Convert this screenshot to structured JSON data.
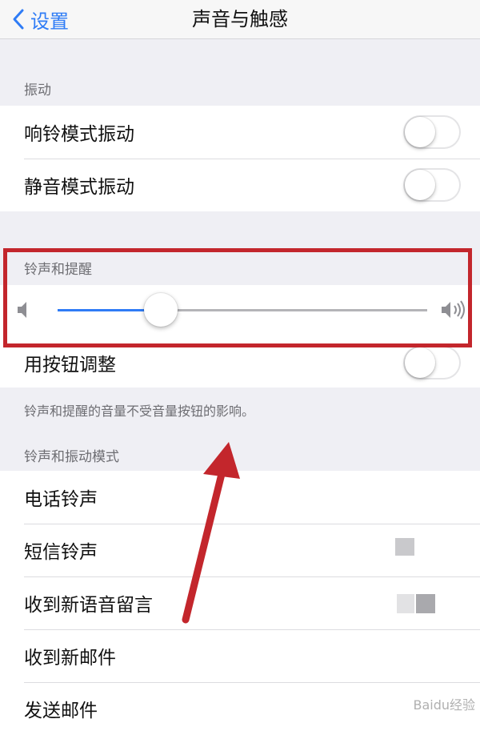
{
  "nav": {
    "back_label": "设置",
    "title": "声音与触感"
  },
  "vibration": {
    "header": "振动",
    "items": [
      {
        "label": "响铃模式振动",
        "on": false
      },
      {
        "label": "静音模式振动",
        "on": false
      }
    ]
  },
  "ringer": {
    "header": "铃声和提醒",
    "volume": 0.28,
    "adjust_label": "用按钮调整",
    "adjust_on": false,
    "footnote": "铃声和提醒的音量不受音量按钮的影响。"
  },
  "patterns": {
    "header": "铃声和振动模式",
    "items": [
      {
        "label": "电话铃声"
      },
      {
        "label": "短信铃声"
      },
      {
        "label": "收到新语音留言"
      },
      {
        "label": "收到新邮件"
      },
      {
        "label": "发送邮件"
      }
    ]
  },
  "colors": {
    "accent": "#2f7cf6",
    "annotation": "#c3262c"
  },
  "watermark": "Baidu经验"
}
